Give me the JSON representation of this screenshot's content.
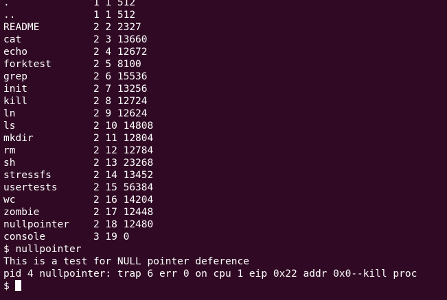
{
  "terminal": {
    "lines": [
      ".              1 1 512",
      "..             1 1 512",
      "README         2 2 2327",
      "cat            2 3 13660",
      "echo           2 4 12672",
      "forktest       2 5 8100",
      "grep           2 6 15536",
      "init           2 7 13256",
      "kill           2 8 12724",
      "ln             2 9 12624",
      "ls             2 10 14808",
      "mkdir          2 11 12804",
      "rm             2 12 12784",
      "sh             2 13 23268",
      "stressfs       2 14 13452",
      "usertests      2 15 56384",
      "wc             2 16 14204",
      "zombie         2 17 12448",
      "nullpointer    2 18 12480",
      "console        3 19 0",
      "$ nullpointer",
      "This is a test for NULL pointer deference",
      "pid 4 nullpointer: trap 6 err 0 on cpu 1 eip 0x22 addr 0x0--kill proc"
    ],
    "prompt": "$ "
  },
  "colors": {
    "background": "#300a24",
    "text": "#ffffff"
  }
}
